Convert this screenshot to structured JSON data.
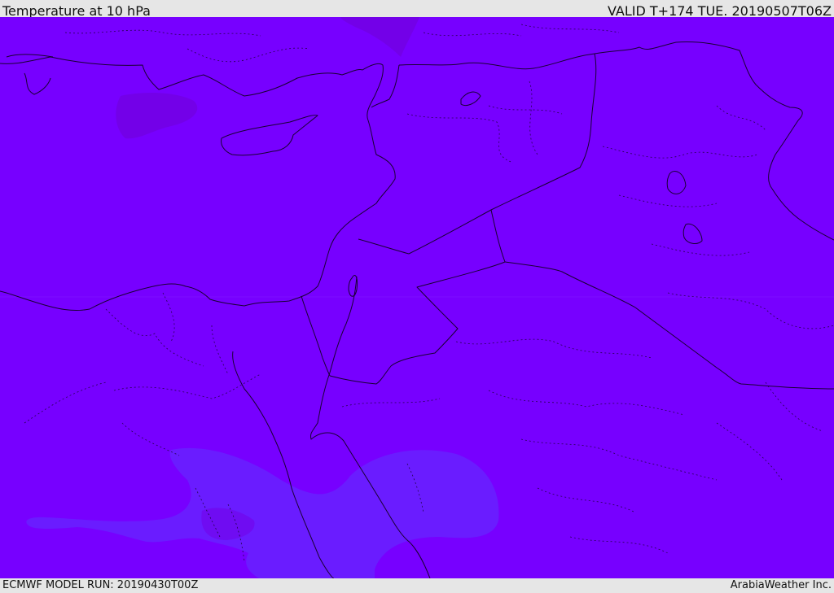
{
  "header": {
    "title": "Temperature at 10 hPa",
    "valid": "VALID T+174 TUE. 20190507T06Z"
  },
  "footer": {
    "model_run": "ECMWF MODEL RUN: 20190430T00Z",
    "credit": "ArabiaWeather Inc."
  },
  "map": {
    "colors": {
      "field": "#7700ff",
      "cold_patch": "#7300e8",
      "warm_patch": "#6a1cff",
      "boundary": "#1a0033"
    }
  }
}
